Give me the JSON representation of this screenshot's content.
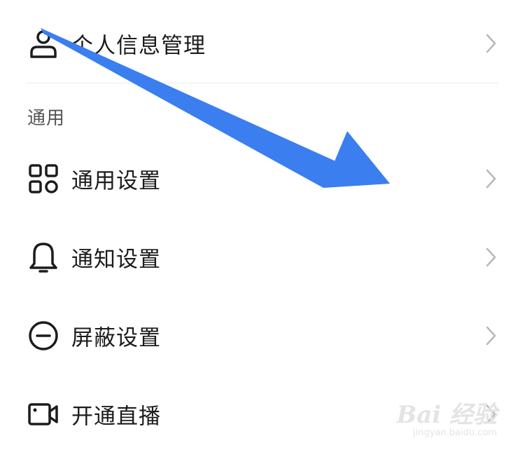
{
  "items": {
    "profile": {
      "label": "个人信息管理",
      "icon": "user-icon"
    },
    "general": {
      "label": "通用设置",
      "icon": "grid-icon"
    },
    "notification": {
      "label": "通知设置",
      "icon": "bell-icon"
    },
    "block": {
      "label": "屏蔽设置",
      "icon": "block-icon"
    },
    "live": {
      "label": "开通直播",
      "icon": "video-camera-icon"
    }
  },
  "section": {
    "title": "通用"
  },
  "annotation": {
    "arrow_color": "#3a7ef0"
  },
  "watermark": {
    "main": "Bai 经验",
    "sub": "jingyan.baidu.com"
  },
  "colors": {
    "text": "#1c1c1c",
    "chevron": "#b8b8b8",
    "divider": "#ebebeb",
    "section": "#555555"
  }
}
